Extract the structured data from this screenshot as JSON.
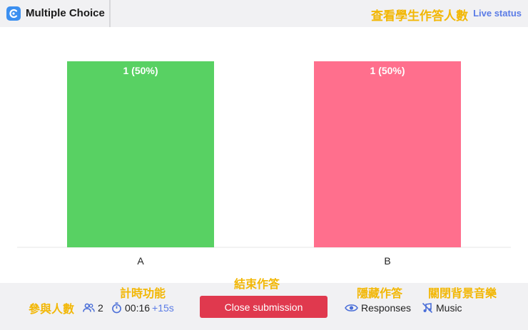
{
  "header": {
    "title": "Multiple Choice",
    "annotation_live": "查看學生作答人數",
    "live_status_label": "Live status",
    "app_icon": "app-logo-icon"
  },
  "chart_data": {
    "type": "bar",
    "categories": [
      "A",
      "B"
    ],
    "values": [
      1,
      1
    ],
    "data_labels": [
      "1 (50%)",
      "1 (50%)"
    ],
    "colors": [
      "#58d163",
      "#ff6f8d"
    ],
    "ylim": [
      0,
      1
    ],
    "grid": false,
    "legend": "none"
  },
  "footer": {
    "annotation_participants": "參與人數",
    "participants_count": "2",
    "participants_icon": "people-icon",
    "annotation_timer": "計時功能",
    "timer_value": "00:16",
    "timer_add": "+15s",
    "timer_icon": "stopwatch-icon",
    "annotation_close": "結束作答",
    "close_label": "Close submission",
    "annotation_hide": "隱藏作答",
    "responses_label": "Responses",
    "responses_icon": "eye-icon",
    "annotation_music": "關閉背景音樂",
    "music_label": "Music",
    "music_icon": "music-off-icon"
  },
  "colors": {
    "accent": "#5b7ce6",
    "annotation": "#f2b705",
    "danger": "#e0394e",
    "panel": "#f1f1f3"
  }
}
